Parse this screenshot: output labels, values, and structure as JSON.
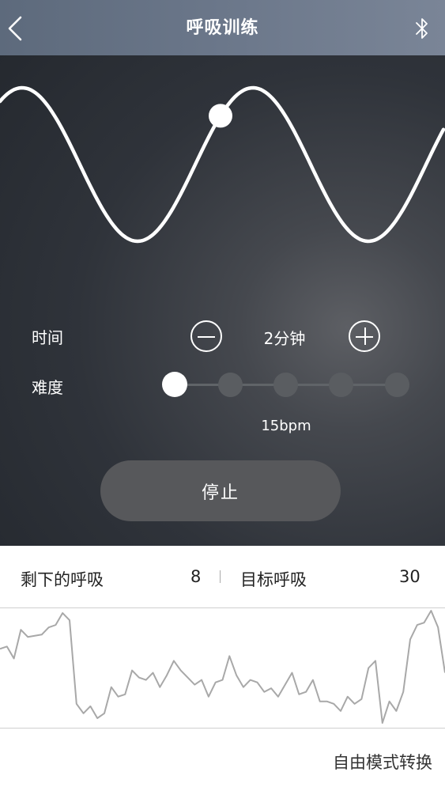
{
  "header": {
    "title": "呼吸训练",
    "back_icon": "chevron-left-icon",
    "bluetooth_icon": "bluetooth-icon"
  },
  "breathing_guide": {
    "progress_fraction": 0.28
  },
  "controls": {
    "time_label": "时间",
    "time_value": "2分钟",
    "difficulty_label": "难度",
    "difficulty_level": 1,
    "difficulty_levels": 5,
    "bpm_label": "15bpm"
  },
  "stop_button": {
    "label": "停止"
  },
  "stats": {
    "remaining_label": "剩下的呼吸",
    "remaining_value": "8",
    "target_label": "目标呼吸",
    "target_value": "30"
  },
  "heart_rate_trace": {
    "y_range": [
      0,
      100
    ],
    "values": [
      66,
      68,
      58,
      82,
      76,
      77,
      78,
      84,
      86,
      96,
      90,
      20,
      12,
      18,
      8,
      12,
      34,
      26,
      28,
      48,
      42,
      40,
      46,
      34,
      44,
      56,
      48,
      42,
      36,
      40,
      26,
      38,
      40,
      60,
      44,
      34,
      40,
      38,
      30,
      33,
      26,
      36,
      46,
      28,
      30,
      40,
      22,
      22,
      20,
      14,
      26,
      20,
      24,
      50,
      56,
      4,
      22,
      14,
      30,
      74,
      86,
      88,
      98,
      84,
      46
    ]
  },
  "footer": {
    "mode_switch_label": "自由模式转换"
  },
  "colors": {
    "panel_dark": "#2a2e35",
    "nav_bar": "#6b778a",
    "stop_button": "#57585b",
    "trace": "#a8a8a8"
  }
}
